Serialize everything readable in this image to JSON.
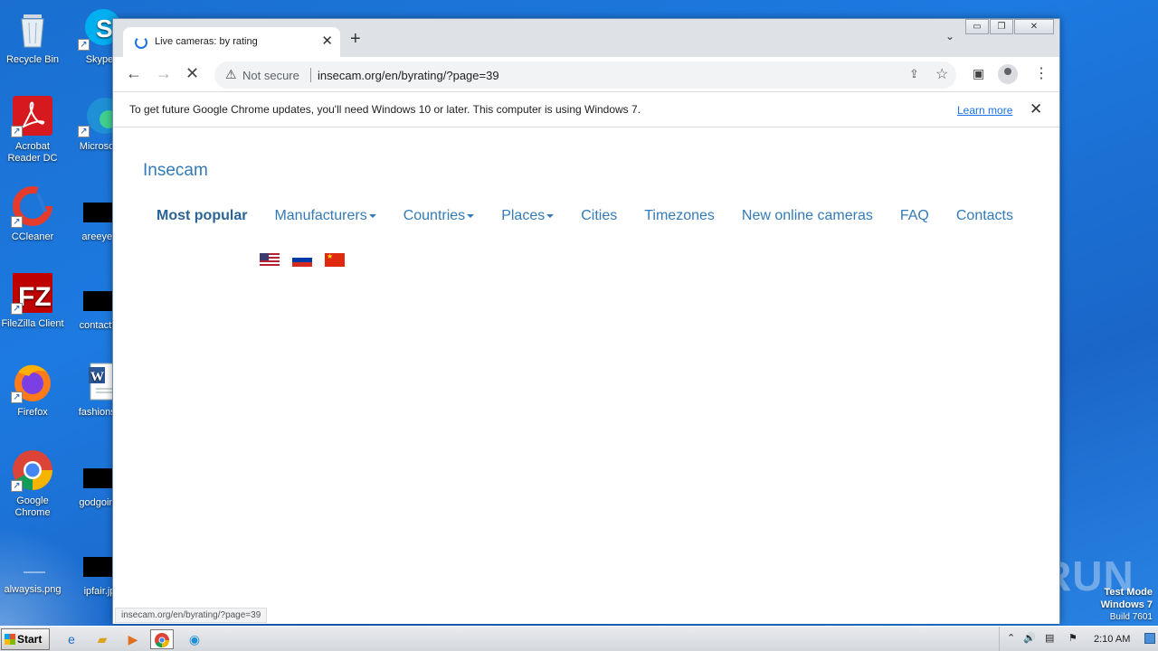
{
  "desktop": {
    "icons_col1": [
      {
        "label": "Recycle Bin",
        "name": "recycle-bin-icon"
      },
      {
        "label": "Acrobat Reader DC",
        "name": "acrobat-reader-icon"
      },
      {
        "label": "CCleaner",
        "name": "ccleaner-icon"
      },
      {
        "label": "FileZilla Client",
        "name": "filezilla-icon"
      },
      {
        "label": "Firefox",
        "name": "firefox-icon"
      },
      {
        "label": "Google Chrome",
        "name": "chrome-icon"
      },
      {
        "label": "alwaysis.png",
        "name": "image-file-icon"
      }
    ],
    "icons_col2": [
      {
        "label": "Skype",
        "name": "skype-icon"
      },
      {
        "label": "Microsoft",
        "name": "edge-icon"
      },
      {
        "label": "areeyes",
        "name": "file-icon"
      },
      {
        "label": "contactfri",
        "name": "file-icon"
      },
      {
        "label": "fashionsy",
        "name": "word-doc-icon"
      },
      {
        "label": "godgoing",
        "name": "file-icon"
      },
      {
        "label": "ipfair.jp",
        "name": "file-icon"
      }
    ],
    "watermark": "ANY RUN",
    "test_mode": {
      "line1": "Test Mode",
      "line2": "Windows 7",
      "line3": "Build 7601"
    }
  },
  "browser": {
    "tab_title": "Live cameras: by rating",
    "tab_close": "✕",
    "new_tab": "+",
    "tab_menu": "⌄",
    "window_buttons": {
      "minimize": "▭",
      "restore": "❐",
      "close": "✕"
    },
    "nav": {
      "back": "←",
      "forward": "→",
      "stop": "✕"
    },
    "omnibox": {
      "warn_icon": "⚠",
      "security_label": "Not secure",
      "url": "insecam.org/en/byrating/?page=39",
      "share_icon": "⇪",
      "star_icon": "☆"
    },
    "toolbar_icons": {
      "side_panel": "▣",
      "menu": "⋮"
    },
    "infobar": {
      "message": "To get future Google Chrome updates, you'll need Windows 10 or later. This computer is using Windows 7.",
      "link": "Learn more",
      "close": "✕"
    },
    "status_url": "insecam.org/en/byrating/?page=39"
  },
  "page": {
    "brand": "Insecam",
    "nav": [
      {
        "label": "Most popular",
        "active": true,
        "dropdown": false
      },
      {
        "label": "Manufacturers",
        "active": false,
        "dropdown": true
      },
      {
        "label": "Countries",
        "active": false,
        "dropdown": true
      },
      {
        "label": "Places",
        "active": false,
        "dropdown": true
      },
      {
        "label": "Cities",
        "active": false,
        "dropdown": false
      },
      {
        "label": "Timezones",
        "active": false,
        "dropdown": false
      },
      {
        "label": "New online cameras",
        "active": false,
        "dropdown": false
      },
      {
        "label": "FAQ",
        "active": false,
        "dropdown": false
      },
      {
        "label": "Contacts",
        "active": false,
        "dropdown": false
      }
    ],
    "flags": [
      "us-flag",
      "russia-flag",
      "china-flag"
    ]
  },
  "taskbar": {
    "start_label": "Start",
    "clock": "2:10 AM",
    "tray_expand": "⌃"
  }
}
